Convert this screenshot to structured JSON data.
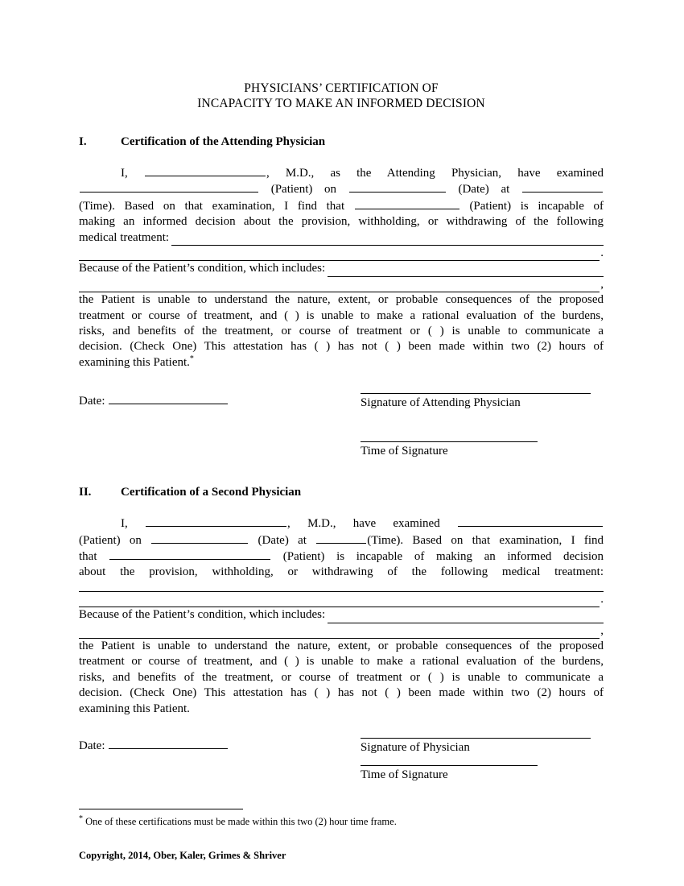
{
  "document": {
    "title_lines": [
      "PHYSICIANS’ CERTIFICATION OF",
      "INCAPACITY TO MAKE AN INFORMED DECISION"
    ],
    "sections": [
      {
        "number": "I.",
        "heading": "Certification of the Attending Physician",
        "line1_a": "I,",
        "line1_b": ", M.D., as the Attending Physician, have examined",
        "line2_a": "(Patient) on",
        "line2_b": "(Date) at",
        "line3_a": "(Time).  Based on that examination, I find that",
        "line3_b": "(Patient) is incapable of",
        "line4": "making an informed decision about the provision, withholding, or withdrawing of the following",
        "line5_label": "medical treatment:",
        "rule_tail_period": ".",
        "because_label": "Because of the Patient’s condition, which includes:",
        "rule_tail_comma": ",",
        "body_line1": "the Patient is unable to understand the nature, extent, or probable consequences of the proposed",
        "body_line2": "treatment or course of treatment, and ( ) is unable to make a rational evaluation of the burdens,",
        "body_line3": "risks, and benefits of the treatment, or course of treatment or ( ) is unable to communicate a",
        "body_line4": "decision.  (Check One) This attestation has ( ) has not ( ) been made within two (2) hours of",
        "body_line5": "examining this Patient.",
        "footnote_marker": "*",
        "date_label": "Date:",
        "signature_label": "Signature of Attending Physician",
        "time_label": "Time of Signature"
      },
      {
        "number": "II.",
        "heading": "Certification of a Second Physician",
        "line1_a": "I,",
        "line1_b": ", M.D.,  have  examined",
        "line2_a": "(Patient) on",
        "line2_b": "(Date) at",
        "line2_c": "(Time).  Based on that examination, I find",
        "line3_a": "that",
        "line3_b": "(Patient) is incapable of making an informed decision",
        "line4": "about  the  provision,  withholding,  or  withdrawing  of  the  following  medical  treatment:",
        "rule_tail_period": ".",
        "because_label": "Because of the Patient’s condition, which includes:",
        "rule_tail_comma": ",",
        "body_line1": "the Patient is unable to understand the nature, extent, or probable consequences of the proposed",
        "body_line2": "treatment or course of treatment, and ( ) is unable to make a rational evaluation of the burdens,",
        "body_line3": "risks, and benefits of the treatment, or course of treatment or ( ) is unable to communicate a",
        "body_line4": "decision.  (Check One) This attestation has ( ) has not ( ) been made within two (2) hours of",
        "body_line5": "examining this Patient.",
        "date_label": "Date:",
        "signature_label": "Signature of Physician",
        "time_label": "Time of Signature"
      }
    ],
    "footnote": {
      "marker": "*",
      "text": "One of these certifications must be made within this two (2) hour time frame."
    },
    "copyright": "Copyright, 2014, Ober, Kaler, Grimes & Shriver"
  }
}
